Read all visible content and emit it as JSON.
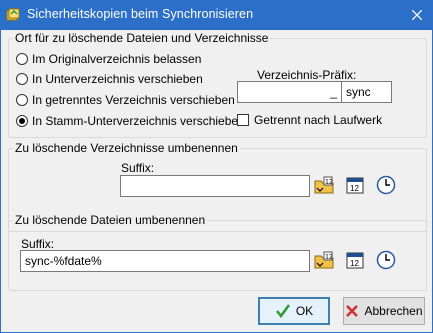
{
  "window": {
    "title": "Sicherheitskopien beim Synchronisieren"
  },
  "deletion_location": {
    "legend": "Ort für zu löschende Dateien und Verzeichnisse",
    "options": [
      {
        "label": "Im Originalverzeichnis belassen",
        "selected": false
      },
      {
        "label": "In Unterverzeichnis verschieben",
        "selected": false
      },
      {
        "label": "In getrenntes Verzeichnis verschieben",
        "selected": false
      },
      {
        "label": "In Stamm-Unterverzeichnis verschieben",
        "selected": true
      }
    ],
    "prefix_label": "Verzeichnis-Präfix:",
    "prefix_value": "_",
    "prefix_suffix_value": "sync",
    "separate_by_drive_label": "Getrennt nach Laufwerk",
    "separate_by_drive_checked": false
  },
  "rename_dirs": {
    "legend": "Zu löschende Verzeichnisse umbenennen",
    "suffix_label": "Suffix:",
    "suffix_value": ""
  },
  "rename_files": {
    "legend": "Zu löschende Dateien umbenennen",
    "suffix_label": "Suffix:",
    "suffix_value": "sync-%fdate%"
  },
  "buttons": {
    "ok": "OK",
    "cancel": "Abbrechen"
  },
  "icons": {
    "placeholder": "folder-placeholder-icon",
    "calendar": "calendar-icon",
    "clock": "clock-icon"
  },
  "colors": {
    "titlebar": "#2b6fc9",
    "ok_check": "#2e9a2e",
    "cancel_x": "#d03030"
  }
}
